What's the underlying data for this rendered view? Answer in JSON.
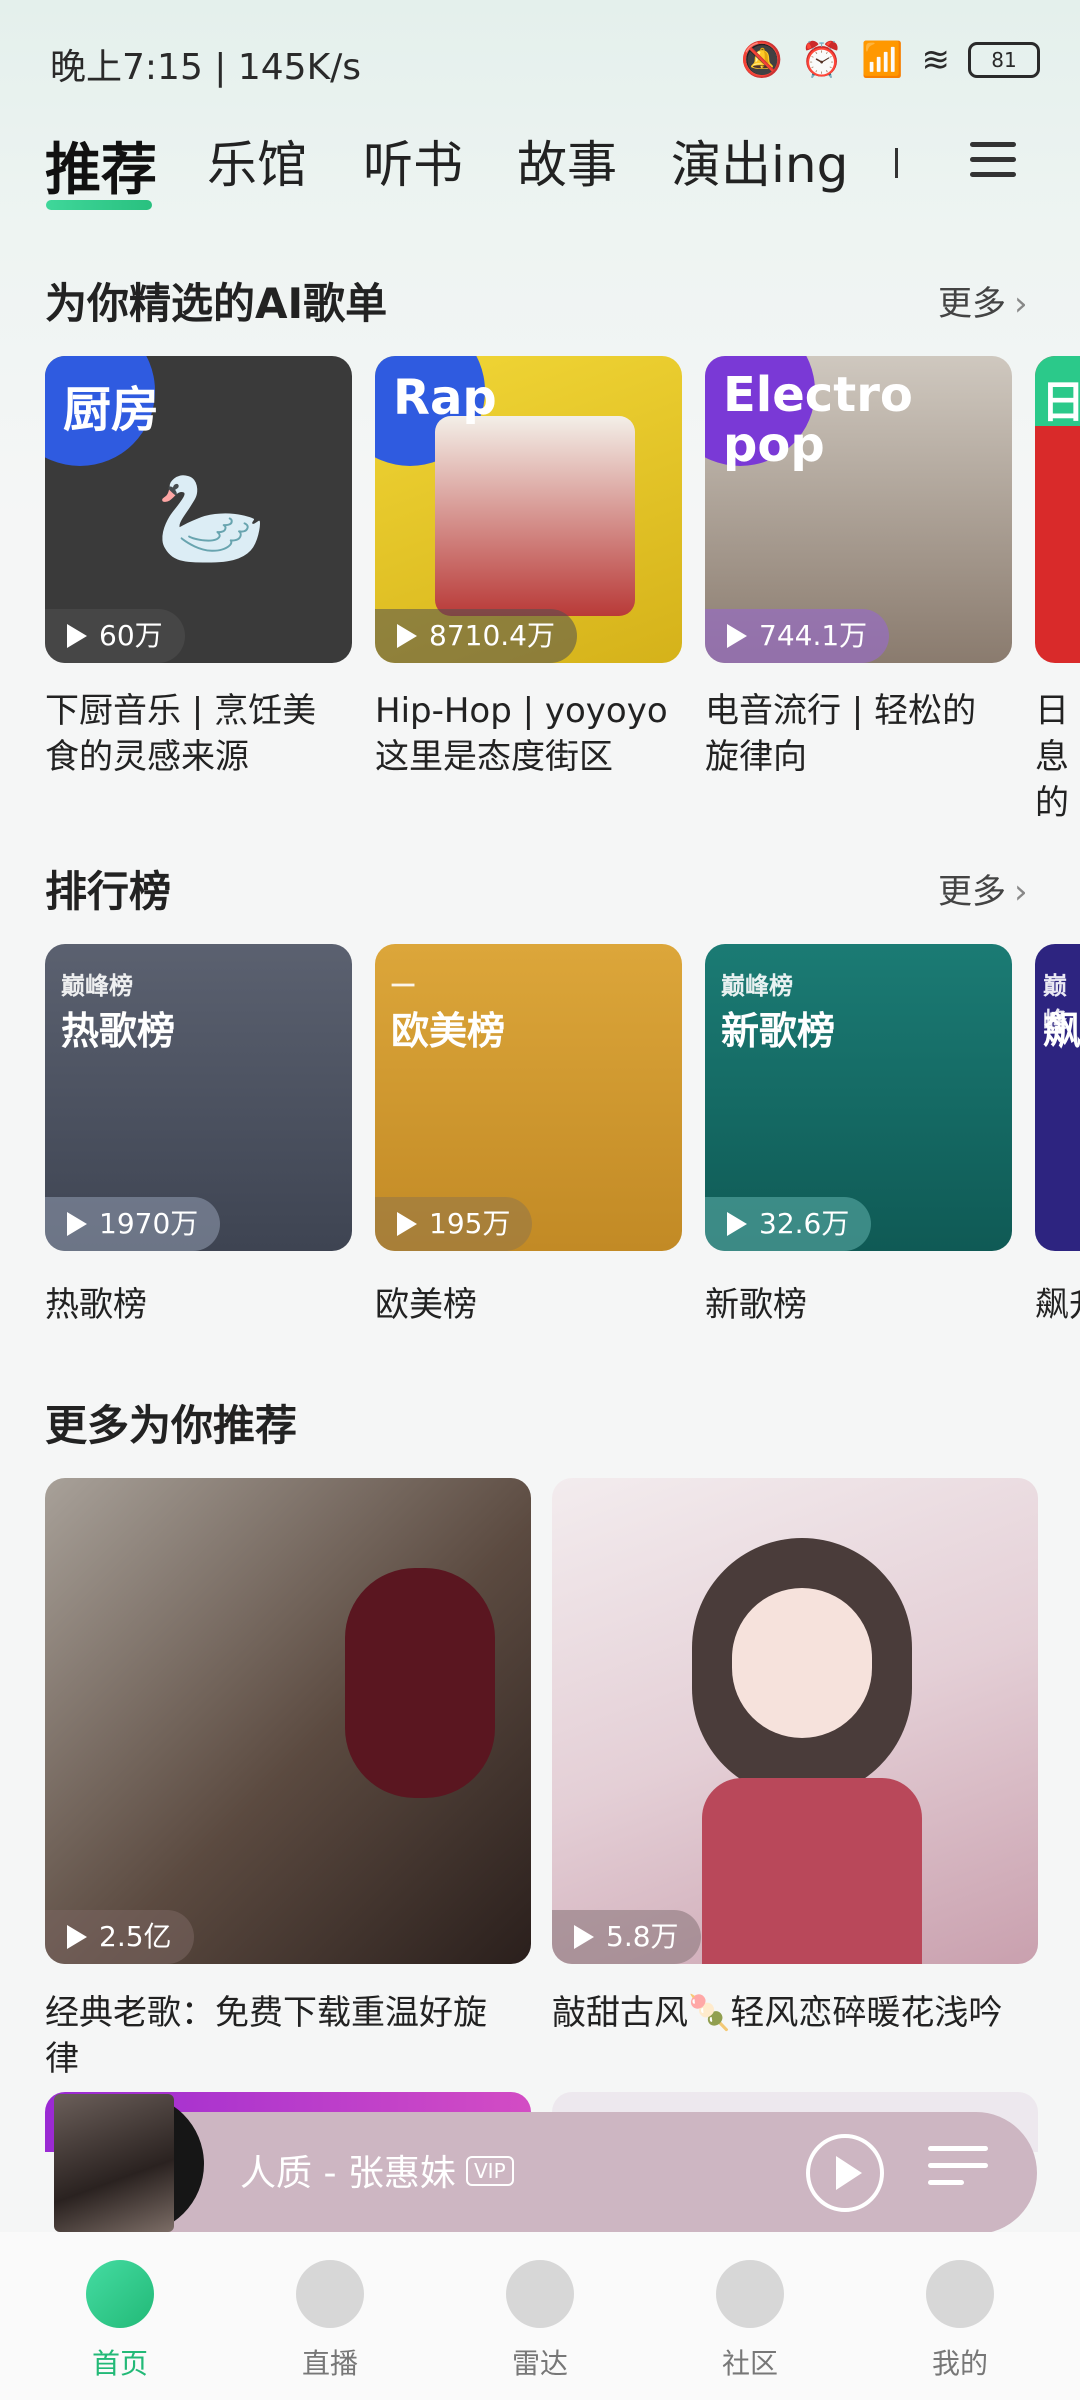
{
  "status": {
    "time": "晚上7:15 | 145K/s",
    "battery": "81"
  },
  "tabs": [
    "推荐",
    "乐馆",
    "听书",
    "故事",
    "演出ing"
  ],
  "ai_section": {
    "title": "为你精选的AI歌单",
    "more": "更多",
    "cards": [
      {
        "tag": "厨房",
        "plays": "60万",
        "title_line1": "下厨音乐 | 烹饪美",
        "title_line2": "食的灵感来源",
        "color": "#3a3a3a"
      },
      {
        "tag": "Rap",
        "plays": "8710.4万",
        "title_line1": "Hip-Hop | yoyoyo",
        "title_line2": "这里是态度街区",
        "color": "#e3c220"
      },
      {
        "tag": "Electro pop",
        "plays": "744.1万",
        "title_line1": "电音流行 | 轻松的",
        "title_line2": "旋律向",
        "color": "#c9c2b6"
      },
      {
        "tag": "日",
        "plays": "",
        "title_line1": "日息",
        "title_line2": "的",
        "color": "#d92a2a"
      }
    ]
  },
  "chart_section": {
    "title": "排行榜",
    "more": "更多",
    "cards": [
      {
        "sub": "巅峰榜",
        "main": "热歌榜",
        "plays": "1970万",
        "title": "热歌榜",
        "color": "#4b5160"
      },
      {
        "sub": "一",
        "main": "欧美榜",
        "plays": "195万",
        "title": "欧美榜",
        "color": "#d29b2e"
      },
      {
        "sub": "巅峰榜",
        "main": "新歌榜",
        "plays": "32.6万",
        "title": "新歌榜",
        "color": "#166b66"
      },
      {
        "sub": "巅峰",
        "main": "飙",
        "plays": "",
        "title": "飙升",
        "color": "#2d2480"
      }
    ]
  },
  "more_section": {
    "title": "更多为你推荐",
    "cards": [
      {
        "plays": "2.5亿",
        "title_line1": "经典老歌：免费下载重温好旋",
        "title_line2": "律",
        "color": "#8a7f78"
      },
      {
        "plays": "5.8万",
        "title_line1": "敲甜古风🍡轻风恋碎暖花浅吟",
        "title_line2": "",
        "color": "#e8d5da"
      }
    ]
  },
  "player": {
    "song": "人质 - 张惠妹",
    "vip": "VIP"
  },
  "nav": [
    "首页",
    "直播",
    "雷达",
    "社区",
    "我的"
  ]
}
